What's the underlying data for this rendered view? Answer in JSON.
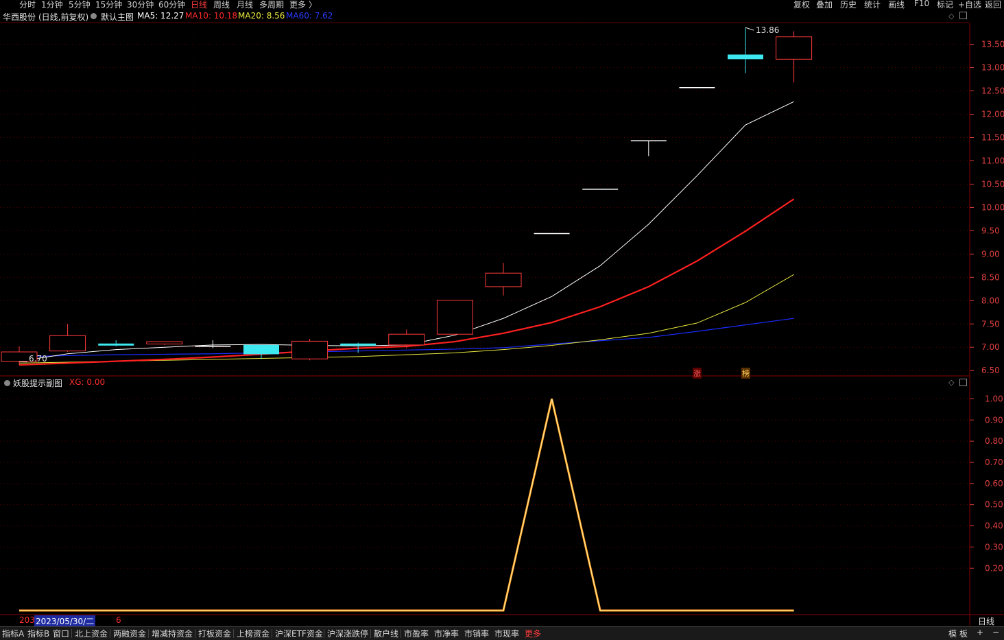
{
  "period_tabs": [
    "分时",
    "1分钟",
    "5分钟",
    "15分钟",
    "30分钟",
    "60分钟",
    "日线",
    "周线",
    "月线",
    "多周期",
    "更多 〉"
  ],
  "active_period": "日线",
  "right_tools": [
    "复权",
    "叠加",
    "历史",
    "统计",
    "画线",
    "F10",
    "标记",
    "+自选",
    "返回"
  ],
  "stock": {
    "name": "华西股份",
    "mode": "(日线,前复权)",
    "template": "默认主图",
    "ma5_label": "MA5: 12.27",
    "ma10_label": "MA10: 10.18",
    "ma20_label": "MA20: 8.56",
    "ma60_label": "MA60: 7.62"
  },
  "colors": {
    "up": "#ff3b3b",
    "down": "#3ee8f0",
    "ma5": "#ffffff",
    "ma10": "#ff2020",
    "ma20": "#e8e840",
    "ma60": "#1a2cff",
    "grid": "#5a0000",
    "axis": "#e04040",
    "indicator": "#ffa020"
  },
  "price_axis": [
    "13.50",
    "13.00",
    "12.50",
    "12.00",
    "11.50",
    "11.00",
    "10.50",
    "10.00",
    "9.50",
    "9.00",
    "8.50",
    "8.00",
    "7.50",
    "7.00",
    "6.50"
  ],
  "high_label": "13.86",
  "low_label": "6.70",
  "badges": [
    "涨",
    "榜"
  ],
  "indicator": {
    "name": "妖股提示副图",
    "value_label": "XG: 0.00",
    "axis": [
      "1.00",
      "0.90",
      "0.80",
      "0.70",
      "0.60",
      "0.50",
      "0.40",
      "0.30",
      "0.20"
    ]
  },
  "chart_data": {
    "type": "candlestick",
    "candles": [
      {
        "open": 6.7,
        "high": 7.02,
        "low": 6.62,
        "close": 6.9
      },
      {
        "open": 6.92,
        "high": 7.5,
        "low": 6.9,
        "close": 7.25
      },
      {
        "open": 7.08,
        "high": 7.15,
        "low": 7.02,
        "close": 7.05
      },
      {
        "open": 7.07,
        "high": 7.13,
        "low": 7.05,
        "close": 7.12
      },
      {
        "open": 7.02,
        "high": 7.15,
        "low": 6.98,
        "close": 7.02
      },
      {
        "open": 7.05,
        "high": 7.05,
        "low": 6.75,
        "close": 6.85
      },
      {
        "open": 6.75,
        "high": 7.18,
        "low": 6.72,
        "close": 7.13
      },
      {
        "open": 7.08,
        "high": 7.1,
        "low": 6.88,
        "close": 7.05
      },
      {
        "open": 7.05,
        "high": 7.38,
        "low": 6.98,
        "close": 7.28
      },
      {
        "open": 7.28,
        "high": 8.01,
        "low": 7.25,
        "close": 8.01
      },
      {
        "open": 8.3,
        "high": 8.81,
        "low": 8.11,
        "close": 8.59
      },
      {
        "open": 9.44,
        "high": 9.44,
        "low": 9.44,
        "close": 9.44
      },
      {
        "open": 10.39,
        "high": 10.39,
        "low": 10.39,
        "close": 10.39
      },
      {
        "open": 11.43,
        "high": 11.43,
        "low": 11.1,
        "close": 11.43
      },
      {
        "open": 12.57,
        "high": 12.57,
        "low": 12.57,
        "close": 12.57
      },
      {
        "open": 13.28,
        "high": 13.86,
        "low": 12.88,
        "close": 13.18
      },
      {
        "open": 13.18,
        "high": 13.78,
        "low": 12.68,
        "close": 13.66
      }
    ],
    "ma5": [
      6.7,
      6.86,
      6.95,
      7.0,
      7.05,
      7.06,
      7.04,
      7.03,
      7.05,
      7.26,
      7.62,
      8.09,
      8.75,
      9.64,
      10.68,
      11.77,
      12.27
    ],
    "ma10": [
      6.62,
      6.66,
      6.7,
      6.74,
      6.79,
      6.85,
      6.92,
      6.98,
      7.02,
      7.12,
      7.3,
      7.53,
      7.87,
      8.3,
      8.85,
      9.49,
      10.18
    ],
    "ma20": [
      6.66,
      6.68,
      6.7,
      6.72,
      6.74,
      6.76,
      6.78,
      6.8,
      6.84,
      6.88,
      6.95,
      7.04,
      7.16,
      7.3,
      7.52,
      7.96,
      8.56
    ],
    "ma60": [
      6.8,
      6.82,
      6.84,
      6.85,
      6.86,
      6.88,
      6.9,
      6.92,
      6.94,
      6.96,
      6.99,
      7.07,
      7.14,
      7.21,
      7.34,
      7.48,
      7.62
    ],
    "ylim": [
      6.4,
      13.95
    ],
    "xg": [
      0,
      0,
      0,
      0,
      0,
      0,
      0,
      0,
      0,
      0,
      0,
      1,
      0,
      0,
      0,
      0,
      0
    ],
    "xg_ylim": [
      0,
      1.05
    ]
  },
  "date_label": "2023/05/30/二",
  "date_prefix": "203",
  "date_suffix": "6",
  "bottom_tabs": [
    "指标A",
    "指标B",
    "窗口",
    "北上资金",
    "两融资金",
    "增减持资金",
    "打板资金",
    "上榜资金",
    "沪深ETF资金",
    "沪深涨跌停",
    "散户线",
    "市盈率",
    "市净率",
    "市销率",
    "市现率",
    "更多"
  ],
  "bottom_right": [
    "模",
    "板",
    "+",
    "−"
  ],
  "period_label_right": "日线"
}
